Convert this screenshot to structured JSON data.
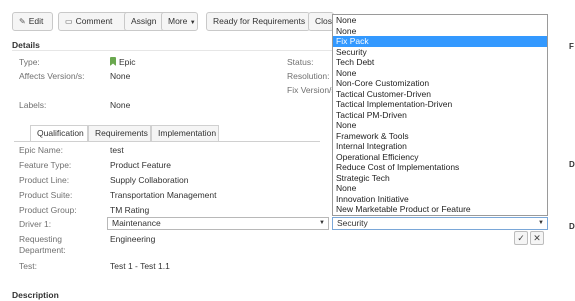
{
  "toolbar": {
    "edit_label": "Edit",
    "comment_label": "Comment",
    "assign_label": "Assign",
    "more_label": "More",
    "ready_label": "Ready for Requirements",
    "close_label": "Close"
  },
  "details": {
    "heading": "Details",
    "type_label": "Type:",
    "type_value": "Epic",
    "affects_label": "Affects Version/s:",
    "affects_value": "None",
    "labels_label": "Labels:",
    "labels_value": "None",
    "status_label": "Status:",
    "resolution_label": "Resolution:",
    "fixversion_label": "Fix Version/s"
  },
  "tabs": [
    "Qualification",
    "Requirements",
    "Implementation"
  ],
  "qualification": {
    "epic_name_label": "Epic Name:",
    "epic_name_value": "test",
    "feature_type_label": "Feature Type:",
    "feature_type_value": "Product Feature",
    "product_line_label": "Product Line:",
    "product_line_value": "Supply Collaboration",
    "product_suite_label": "Product Suite:",
    "product_suite_value": "Transportation Management",
    "product_group_label": "Product Group:",
    "product_group_value": "TM Rating",
    "driver1_label": "Driver 1:",
    "driver1_value": "Maintenance",
    "driver2_value": "Security",
    "requesting_label_1": "Requesting",
    "requesting_label_2": "Department:",
    "requesting_value": "Engineering",
    "test_label": "Test:",
    "test_value": "Test 1 - Test 1.1"
  },
  "description": {
    "heading": "Description"
  },
  "dropdown": {
    "selected_index": 2,
    "options": [
      "None",
      "None",
      "Fix Pack",
      "Security",
      "Tech Debt",
      "None",
      "Non-Core Customization",
      "Tactical Customer-Driven",
      "Tactical Implementation-Driven",
      "Tactical PM-Driven",
      "None",
      "Framework & Tools",
      "Internal Integration",
      "Operational Efficiency",
      "Reduce Cost of Implementations",
      "Strategic Tech",
      "None",
      "Innovation Initiative",
      "New Marketable Product or Feature"
    ]
  },
  "icons": {
    "edit": "pencil-icon",
    "comment": "speech-bubble-icon",
    "epic": "epic-flag-icon",
    "confirm": "check-icon",
    "cancel": "close-icon"
  },
  "colors": {
    "highlight": "#3399ff",
    "epic_green": "#6aa84f",
    "button_bg": "#f5f5f5"
  }
}
